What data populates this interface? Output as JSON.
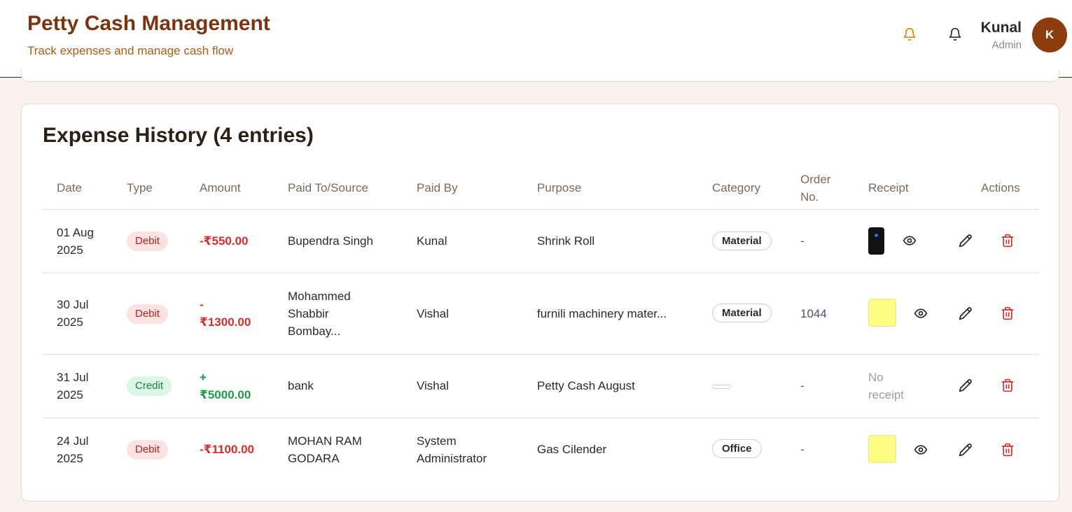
{
  "header": {
    "title": "Petty Cash Management",
    "subtitle": "Track expenses and manage cash flow",
    "user_name": "Kunal",
    "user_role": "Admin",
    "avatar_initial": "K"
  },
  "expense_history": {
    "title": "Expense History (4 entries)",
    "columns": {
      "date": "Date",
      "type": "Type",
      "amount": "Amount",
      "paid_to": "Paid To/Source",
      "paid_by": "Paid By",
      "purpose": "Purpose",
      "category": "Category",
      "order_line1": "Order",
      "order_line2": "No.",
      "receipt": "Receipt",
      "actions": "Actions"
    },
    "rows": [
      {
        "date_line1": "01 Aug",
        "date_line2": "2025",
        "type": "Debit",
        "amount_line1": "-₹550.00",
        "amount_line2": "",
        "paid_to_line1": "Bupendra Singh",
        "paid_to_line2": "",
        "paid_to_line3": "",
        "paid_by_line1": "Kunal",
        "paid_by_line2": "",
        "purpose": "Shrink Roll",
        "category": "Material",
        "order_no": "-",
        "receipt": "phone-screenshot-thumbnail"
      },
      {
        "date_line1": "30 Jul",
        "date_line2": "2025",
        "type": "Debit",
        "amount_line1": "-",
        "amount_line2": "₹1300.00",
        "paid_to_line1": "Mohammed",
        "paid_to_line2": "Shabbir",
        "paid_to_line3": "Bombay...",
        "paid_by_line1": "Vishal",
        "paid_by_line2": "",
        "purpose": "furnili machinery mater...",
        "category": "Material",
        "order_no": "1044",
        "receipt": "yellow-thumbnail"
      },
      {
        "date_line1": "31 Jul",
        "date_line2": "2025",
        "type": "Credit",
        "amount_line1": "+",
        "amount_line2": "₹5000.00",
        "paid_to_line1": "bank",
        "paid_to_line2": "",
        "paid_to_line3": "",
        "paid_by_line1": "Vishal",
        "paid_by_line2": "",
        "purpose": "Petty Cash August",
        "category": "",
        "order_no": "-",
        "receipt_line1": "No",
        "receipt_line2": "receipt"
      },
      {
        "date_line1": "24 Jul",
        "date_line2": "2025",
        "type": "Debit",
        "amount_line1": "-₹1100.00",
        "amount_line2": "",
        "paid_to_line1": "MOHAN RAM",
        "paid_to_line2": "GODARA",
        "paid_to_line3": "",
        "paid_by_line1": "System",
        "paid_by_line2": "Administrator",
        "purpose": "Gas Cilender",
        "category": "Office",
        "order_no": "-",
        "receipt": "yellow-thumbnail"
      }
    ]
  },
  "colors": {
    "brand": "#7a3410",
    "accent": "#b45a14",
    "debit": "#d62f2f",
    "credit": "#1e9a4b",
    "delete": "#d62f2f"
  }
}
